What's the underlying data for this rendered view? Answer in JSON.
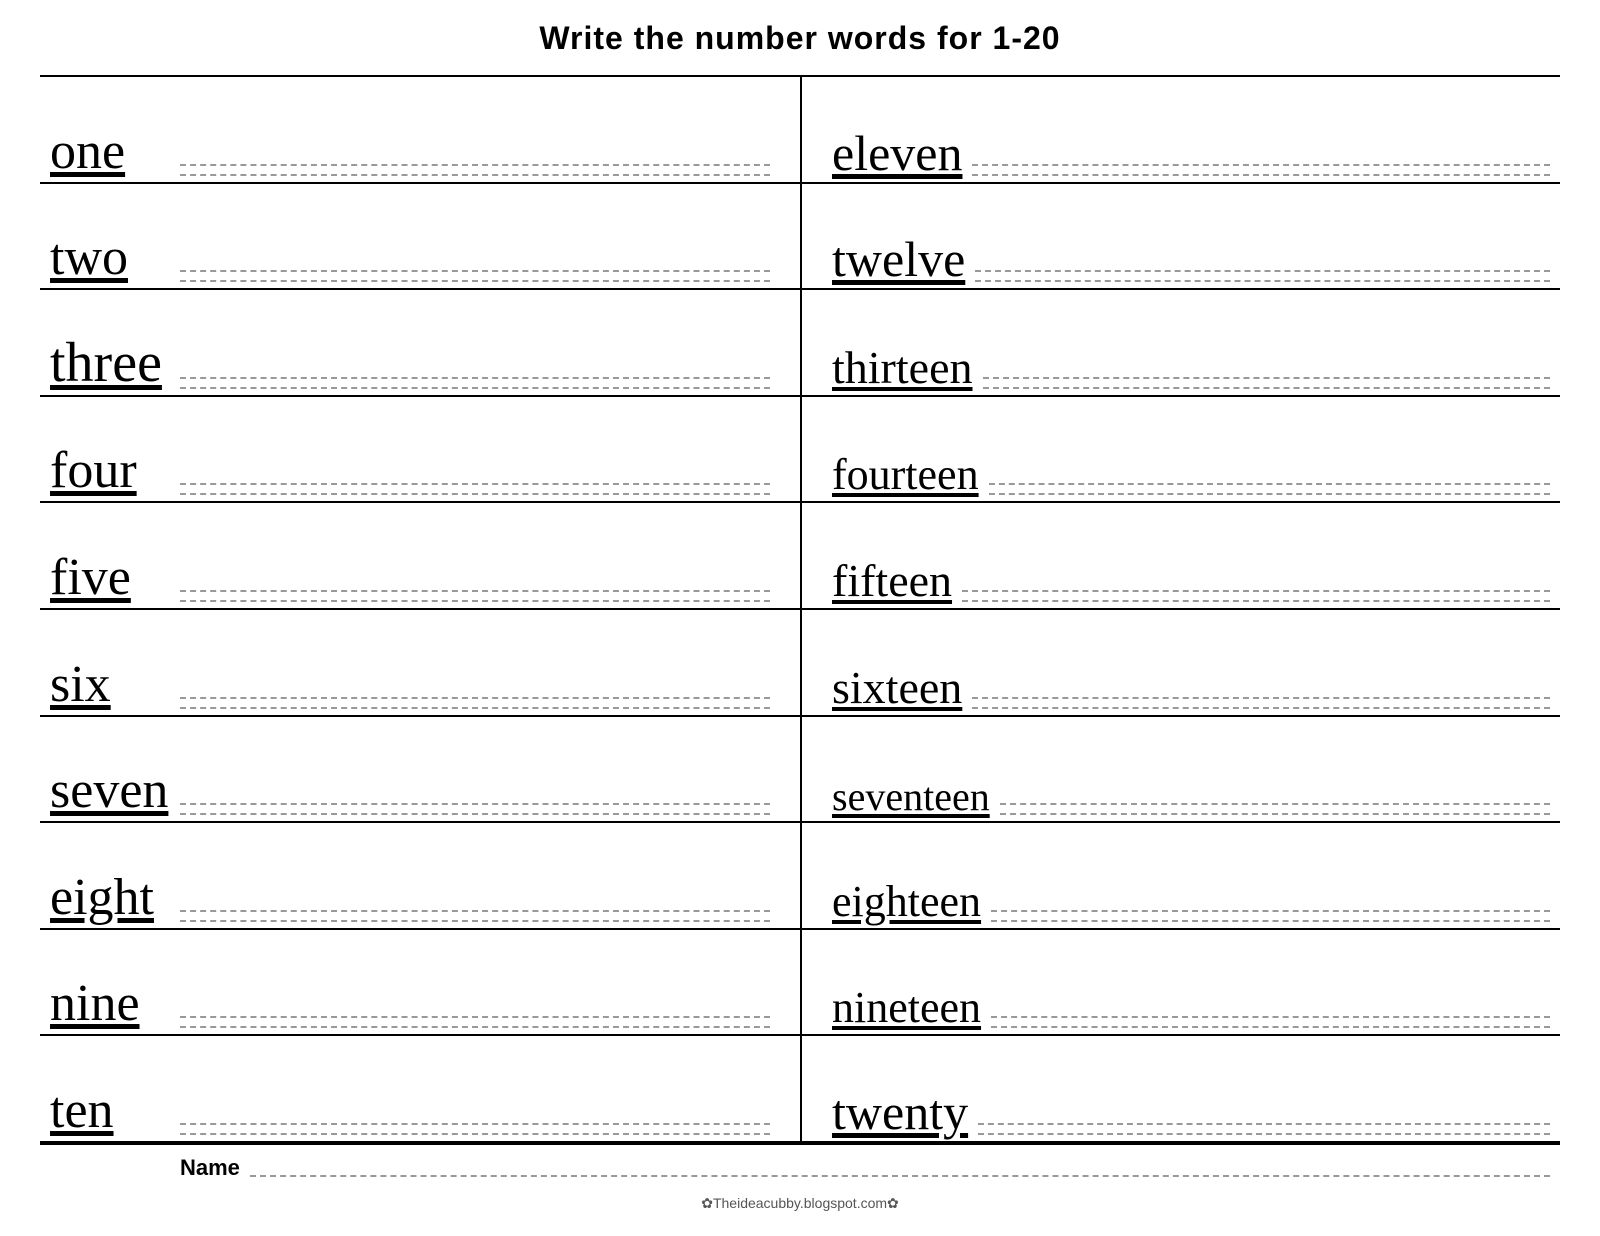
{
  "title": "Write the number words for  1-20",
  "left_words": [
    {
      "word": "one",
      "size": ""
    },
    {
      "word": "two",
      "size": ""
    },
    {
      "word": "three",
      "size": "size-three"
    },
    {
      "word": "four",
      "size": ""
    },
    {
      "word": "five",
      "size": ""
    },
    {
      "word": "six",
      "size": ""
    },
    {
      "word": "seven",
      "size": "size-seven"
    },
    {
      "word": "eight",
      "size": "size-eight"
    },
    {
      "word": "nine",
      "size": "size-nine"
    },
    {
      "word": "ten",
      "size": ""
    }
  ],
  "right_words": [
    {
      "word": "eleven",
      "size": "size-eleven"
    },
    {
      "word": "twelve",
      "size": "size-twelve"
    },
    {
      "word": "thirteen",
      "size": "size-thirteen"
    },
    {
      "word": "fourteen",
      "size": "size-fourteen"
    },
    {
      "word": "fifteen",
      "size": "size-fifteen"
    },
    {
      "word": "sixteen",
      "size": "size-sixteen"
    },
    {
      "word": "seventeen",
      "size": "size-seventeen"
    },
    {
      "word": "eighteen",
      "size": "size-eighteen"
    },
    {
      "word": "nineteen",
      "size": "size-nineteen"
    },
    {
      "word": "twenty",
      "size": "size-twenty"
    }
  ],
  "name_label": "Name",
  "footer_text": "✿Theideacubby.blogspot.com✿"
}
